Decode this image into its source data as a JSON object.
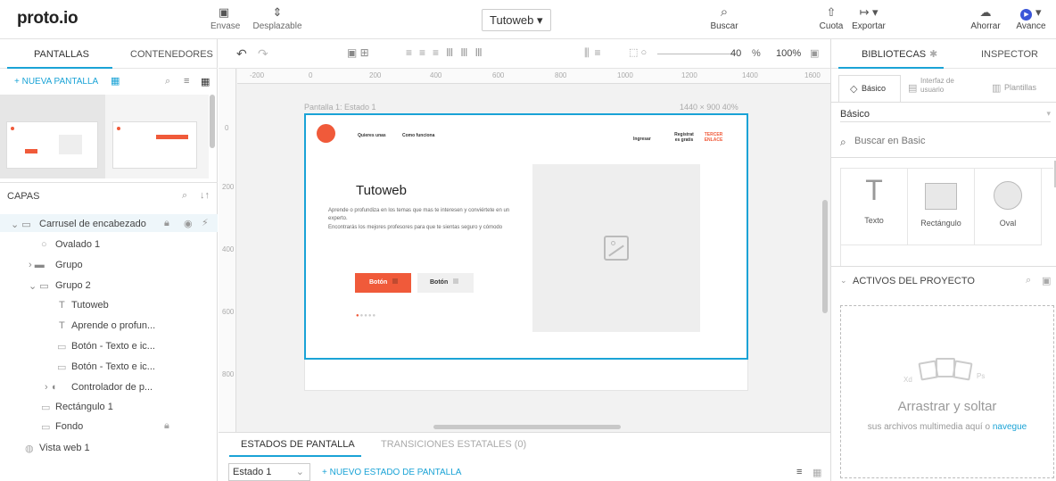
{
  "app": {
    "logo": "proto.io"
  },
  "topbar": {
    "envase": "Envase",
    "desplazable": "Desplazable",
    "project_title": "Tutoweb ▾",
    "buscar": "Buscar",
    "cuota": "Cuota",
    "exportar": "Exportar",
    "ahorrar": "Ahorrar",
    "avance": "Avance"
  },
  "left": {
    "tab_screens": "PANTALLAS",
    "tab_containers": "CONTENEDORES",
    "new_screen": "+ NUEVA PANTALLA",
    "layers_title": "CAPAS",
    "layers": [
      {
        "label": "Carrusel de encabezado"
      },
      {
        "label": "Ovalado 1"
      },
      {
        "label": "Grupo"
      },
      {
        "label": "Grupo 2"
      },
      {
        "label": "Tutoweb"
      },
      {
        "label": "Aprende o profun..."
      },
      {
        "label": "Botón - Texto e ic..."
      },
      {
        "label": "Botón - Texto e ic..."
      },
      {
        "label": "Controlador de p..."
      },
      {
        "label": "Rectángulo 1"
      },
      {
        "label": "Fondo"
      },
      {
        "label": "Vista web 1"
      }
    ]
  },
  "toolbar": {
    "zoom_value": "40",
    "zoom_unit": "%",
    "zoom_reset": "100%"
  },
  "ruler": {
    "h": [
      "-200",
      "0",
      "200",
      "400",
      "600",
      "800",
      "1000",
      "1200",
      "1400",
      "1600"
    ],
    "v": [
      "0",
      "200",
      "400",
      "600",
      "800"
    ]
  },
  "canvas": {
    "screen_label": "Pantalla 1: Estado 1",
    "screen_dims": "1440 × 900  40%",
    "nav": [
      "Quieres unas",
      "Como funciona"
    ],
    "nav_ingresar": "Ingresar",
    "nav_register": "Regístrat es gratis",
    "nav_third": "TERCER ENLACE",
    "hero_title": "Tutoweb",
    "hero_text_1": "Aprende o profundiza en los temas que mas te interesen y conviértete en un experto.",
    "hero_text_2": "Encontrarás los mejores profesores para que te sientas seguro y cómodo",
    "btn_primary": "Botón",
    "btn_secondary": "Botón"
  },
  "bottom": {
    "tab_states": "ESTADOS DE PANTALLA",
    "tab_transitions": "TRANSICIONES ESTATALES (0)",
    "state_select": "Estado 1",
    "new_state": "+ NUEVO ESTADO DE PANTALLA"
  },
  "right": {
    "tab_libraries": "BIBLIOTECAS",
    "tab_inspector": "INSPECTOR",
    "sub_basic": "Básico",
    "sub_ui": "Interfaz de usuario",
    "sub_templates": "Plantillas",
    "lib_select": "Básico",
    "search_placeholder": "Buscar en Basic",
    "items": [
      "Texto",
      "Rectángulo",
      "Oval"
    ],
    "assets_title": "ACTIVOS DEL PROYECTO",
    "drop_title": "Arrastrar y soltar",
    "drop_sub": "sus archivos multimedia aquí o",
    "drop_link": "navegue"
  },
  "colors": {
    "accent": "#1aa3d6",
    "brand_orange": "#f05a3a"
  }
}
